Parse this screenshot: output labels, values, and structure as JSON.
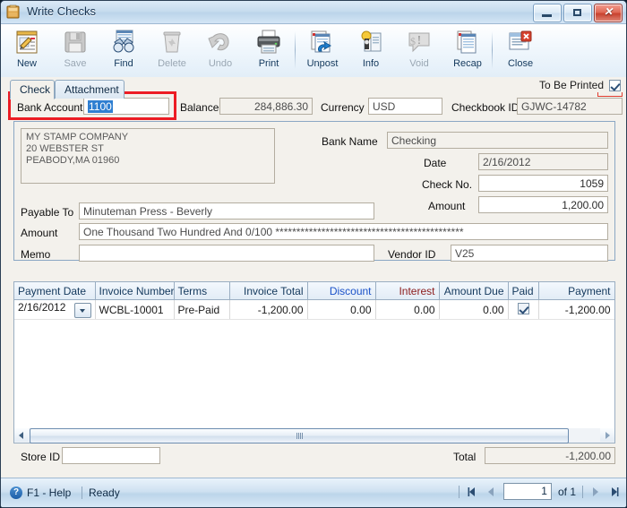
{
  "window": {
    "title": "Write Checks",
    "icon": "document-window-icon",
    "minimize_label": "Minimize",
    "maximize_label": "Maximize",
    "close_label": "Close"
  },
  "toolbar": {
    "items": [
      {
        "label": "New",
        "icon": "new-document-icon",
        "enabled": true
      },
      {
        "label": "Save",
        "icon": "floppy-disk-icon",
        "enabled": false
      },
      {
        "label": "Find",
        "icon": "binoculars-icon",
        "enabled": true
      },
      {
        "label": "Delete",
        "icon": "trash-can-icon",
        "enabled": false
      },
      {
        "label": "Undo",
        "icon": "undo-arrow-icon",
        "enabled": false
      },
      {
        "label": "Print",
        "icon": "printer-icon",
        "enabled": true
      },
      {
        "label": "Unpost",
        "icon": "unpost-icon",
        "enabled": true
      },
      {
        "label": "Info",
        "icon": "info-book-icon",
        "enabled": true
      },
      {
        "label": "Void",
        "icon": "void-stamp-icon",
        "enabled": false
      },
      {
        "label": "Recap",
        "icon": "recap-pages-icon",
        "enabled": true
      },
      {
        "label": "Close",
        "icon": "close-window-icon",
        "enabled": true
      }
    ]
  },
  "tabs": [
    {
      "label": "Check",
      "active": true
    },
    {
      "label": "Attachment",
      "active": false
    }
  ],
  "to_be_printed": {
    "label": "To Be Printed",
    "checked": true
  },
  "header_fields": {
    "bank_account": {
      "label": "Bank Account",
      "value": "1100",
      "selected": true
    },
    "balance": {
      "label": "Balance",
      "value": "284,886.30"
    },
    "currency": {
      "label": "Currency",
      "value": "USD"
    },
    "checkbook_id": {
      "label": "Checkbook ID",
      "value": "GJWC-14782"
    }
  },
  "address": {
    "line1": "MY STAMP COMPANY",
    "line2": "20 WEBSTER ST",
    "line3": "PEABODY,MA 01960"
  },
  "check_fields": {
    "payable_to": {
      "label": "Payable To",
      "value": "Minuteman Press - Beverly"
    },
    "amount_words": {
      "label": "Amount",
      "value": "One Thousand Two Hundred  And 0/100 *********************************************"
    },
    "memo": {
      "label": "Memo",
      "value": ""
    },
    "bank_name": {
      "label": "Bank Name",
      "value": "Checking"
    },
    "date": {
      "label": "Date",
      "value": "2/16/2012"
    },
    "check_no": {
      "label": "Check No.",
      "value": "1059"
    },
    "amount": {
      "label": "Amount",
      "value": "1,200.00"
    },
    "vendor_id": {
      "label": "Vendor ID",
      "value": "V25"
    }
  },
  "grid": {
    "columns": [
      {
        "label": "Payment Date",
        "align": "left",
        "color": "default"
      },
      {
        "label": "Invoice Number",
        "align": "left",
        "color": "default"
      },
      {
        "label": "Terms",
        "align": "left",
        "color": "default"
      },
      {
        "label": "Invoice Total",
        "align": "right",
        "color": "default"
      },
      {
        "label": "Discount",
        "align": "right",
        "color": "#1b52c8"
      },
      {
        "label": "Interest",
        "align": "right",
        "color": "#8b1a1a"
      },
      {
        "label": "Amount Due",
        "align": "right",
        "color": "default"
      },
      {
        "label": "Paid",
        "align": "left",
        "color": "default"
      },
      {
        "label": "Payment",
        "align": "right",
        "color": "default"
      }
    ],
    "rows": [
      {
        "payment_date": "2/16/2012",
        "invoice_number": "WCBL-10001",
        "terms": "Pre-Paid",
        "invoice_total": "-1,200.00",
        "discount": "0.00",
        "interest": "0.00",
        "amount_due": "0.00",
        "paid": true,
        "payment": "-1,200.00"
      }
    ]
  },
  "footer": {
    "store_id": {
      "label": "Store ID",
      "value": ""
    },
    "total": {
      "label": "Total",
      "value": "-1,200.00"
    }
  },
  "status": {
    "help_label": "F1 - Help",
    "state": "Ready",
    "page_value": "1",
    "of_label": "of 1",
    "first_label": "First",
    "prev_label": "Previous",
    "next_label": "Next",
    "last_label": "Last"
  },
  "colors": {
    "highlight_box": "#ec1c24",
    "selection": "#2f7fd1",
    "discount_header": "#1b52c8",
    "interest_header": "#8b1a1a"
  }
}
